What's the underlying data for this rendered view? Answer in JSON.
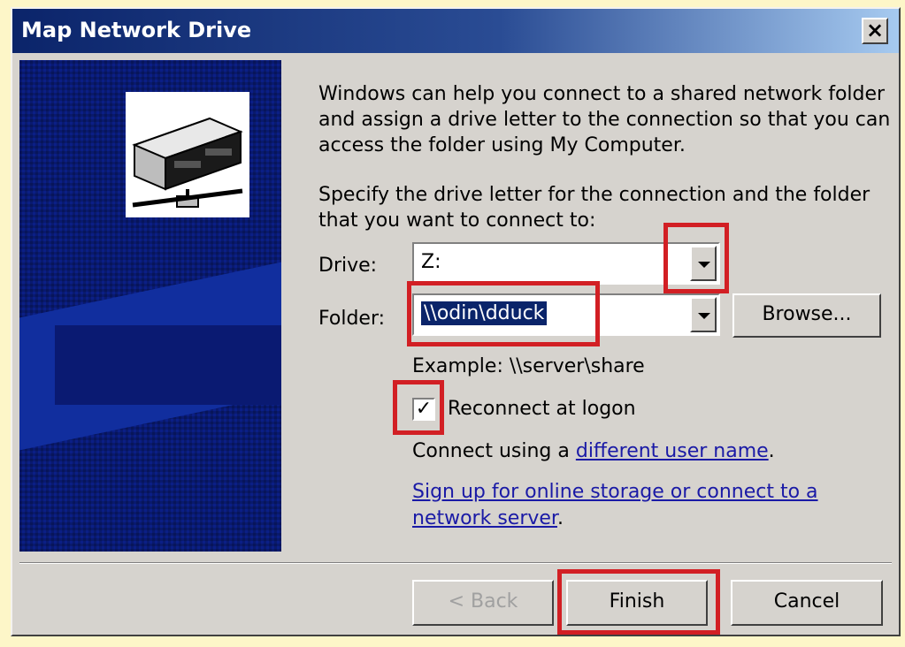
{
  "window": {
    "title": "Map Network Drive",
    "close_label": "×"
  },
  "intro": {
    "text1": "Windows can help you connect to a shared network folder and assign a drive letter to the connection so that you can access the folder using My Computer.",
    "text2": "Specify the drive letter for the connection and the folder that you want to connect to:"
  },
  "form": {
    "drive_label": "Drive:",
    "drive_value": "Z:",
    "folder_label": "Folder:",
    "folder_value": "\\\\odin\\dduck",
    "browse_label": "Browse...",
    "example": "Example: \\\\server\\share",
    "reconnect_label": "Reconnect at logon",
    "reconnect_checked": true,
    "connect_prefix": "Connect using a ",
    "connect_link": "different user name",
    "connect_suffix": ".",
    "signup_link": "Sign up for online storage or connect to a network server",
    "signup_suffix": "."
  },
  "buttons": {
    "back": "< Back",
    "finish": "Finish",
    "cancel": "Cancel"
  },
  "colors": {
    "titlebar": "#0b246a",
    "highlight": "#d21f24",
    "side_panel": "#0b1f86"
  }
}
